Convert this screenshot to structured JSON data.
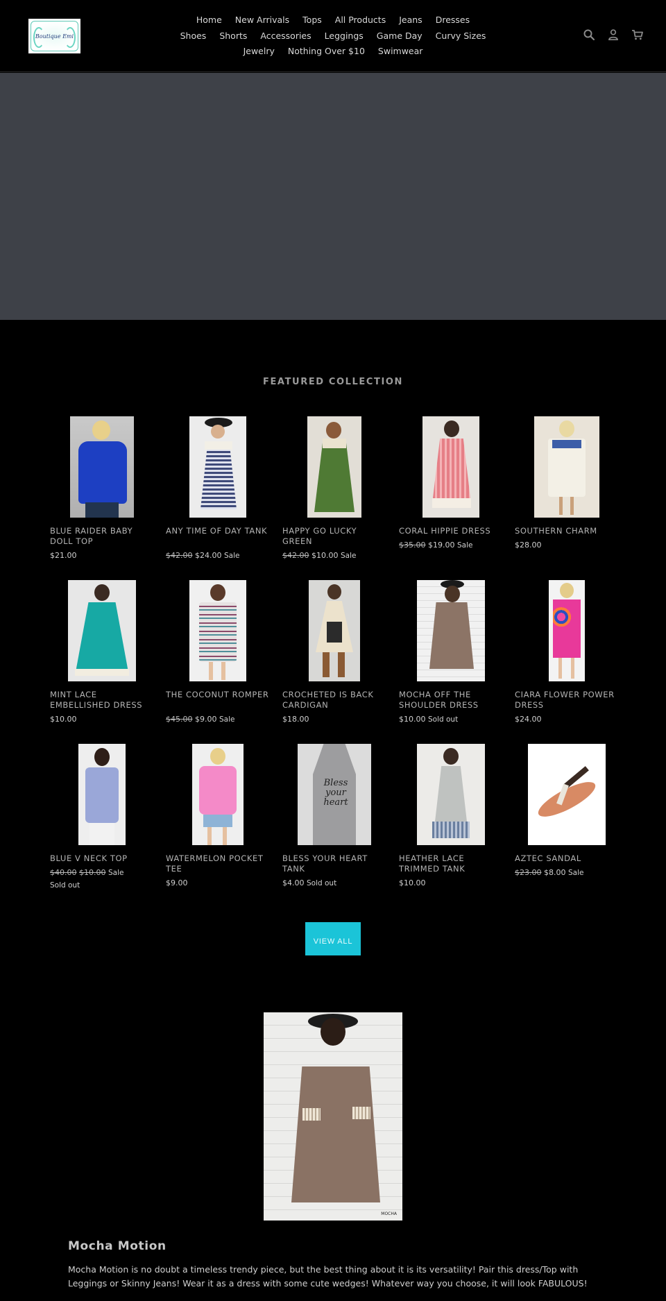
{
  "brand": {
    "logo_text": "Boutique Emi"
  },
  "nav": {
    "row1": [
      "Home",
      "New Arrivals",
      "Tops",
      "All Products",
      "Jeans",
      "Dresses"
    ],
    "row2": [
      "Shoes",
      "Shorts",
      "Accessories",
      "Leggings",
      "Game Day",
      "Curvy Sizes"
    ],
    "row3": [
      "Jewelry",
      "Nothing Over $10",
      "Swimwear"
    ]
  },
  "header_icons": [
    "search-icon",
    "account-icon",
    "cart-icon"
  ],
  "featured": {
    "title": "FEATURED COLLECTION",
    "products": [
      {
        "title": "BLUE RAIDER BABY DOLL TOP",
        "regular": "",
        "price": "$21.00",
        "tag": ""
      },
      {
        "title": "ANY TIME OF DAY TANK",
        "regular": "$42.00",
        "price": "$24.00",
        "tag": "Sale"
      },
      {
        "title": "HAPPY GO LUCKY GREEN",
        "regular": "$42.00",
        "price": "$10.00",
        "tag": "Sale"
      },
      {
        "title": "CORAL HIPPIE DRESS",
        "regular": "$35.00",
        "price": "$19.00",
        "tag": "Sale"
      },
      {
        "title": "SOUTHERN CHARM",
        "regular": "",
        "price": "$28.00",
        "tag": ""
      },
      {
        "title": "MINT LACE EMBELLISHED DRESS",
        "regular": "",
        "price": "$10.00",
        "tag": ""
      },
      {
        "title": "THE COCONUT ROMPER",
        "regular": "$45.00",
        "price": "$9.00",
        "tag": "Sale"
      },
      {
        "title": "CROCHETED IS BACK CARDIGAN",
        "regular": "",
        "price": "$18.00",
        "tag": ""
      },
      {
        "title": "MOCHA OFF THE SHOULDER DRESS",
        "regular": "",
        "price": "$10.00",
        "tag": "Sold out"
      },
      {
        "title": "CIARA FLOWER POWER DRESS",
        "regular": "",
        "price": "$24.00",
        "tag": ""
      },
      {
        "title": "BLUE V NECK TOP",
        "regular": "$40.00",
        "price": "$10.00",
        "tag": "Sale",
        "tag2": "Sold out"
      },
      {
        "title": "WATERMELON POCKET TEE",
        "regular": "",
        "price": "$9.00",
        "tag": ""
      },
      {
        "title": "BLESS YOUR HEART TANK",
        "regular": "",
        "price": "$4.00",
        "tag": "Sold out"
      },
      {
        "title": "HEATHER LACE TRIMMED TANK",
        "regular": "",
        "price": "$10.00",
        "tag": ""
      },
      {
        "title": "AZTEC SANDAL",
        "regular": "$23.00",
        "price": "$8.00",
        "tag": "Sale"
      }
    ],
    "view_all_label": "VIEW ALL"
  },
  "tank_print": "Bless your heart",
  "feature": {
    "image_caption": "MOCHA",
    "title": "Mocha Motion",
    "text": "Mocha Motion is no doubt a timeless trendy piece, but the best thing about it is its versatility! Pair this dress/Top with Leggings or Skinny Jeans! Wear it as a dress with some cute wedges! Whatever way you choose, it will look FABULOUS!"
  },
  "colors": {
    "accent": "#1bc4d8",
    "hero_bg": "#3e4148",
    "page_bg": "#000000"
  }
}
